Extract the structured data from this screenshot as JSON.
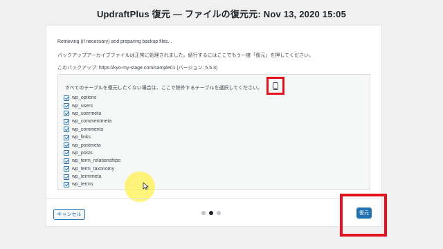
{
  "dialog": {
    "title": "UpdraftPlus 復元 — ファイルの復元元: Nov 13, 2020 15:05"
  },
  "panel": {
    "status_line": "Retrieving (if necessary) and preparing backup files...",
    "processed_message": "バックアップアーカイブファイルは正常に処理されました。続行するにはここでもう一度「復元」を押してください。",
    "backup_line": "このバックアップ: https://kyo-my-stage.com/sample01 (バージョン: 5.5.3)",
    "table_select_hint": "すべてのテーブルを復元したくない場合は、ここで除外するテーブルを選択してください。",
    "tables": [
      {
        "name": "wp_options",
        "checked": true
      },
      {
        "name": "wp_users",
        "checked": true
      },
      {
        "name": "wp_usermeta",
        "checked": true
      },
      {
        "name": "wp_commentmeta",
        "checked": true
      },
      {
        "name": "wp_comments",
        "checked": true
      },
      {
        "name": "wp_links",
        "checked": true
      },
      {
        "name": "wp_postmeta",
        "checked": true
      },
      {
        "name": "wp_posts",
        "checked": true
      },
      {
        "name": "wp_term_relationships",
        "checked": true
      },
      {
        "name": "wp_term_taxonomy",
        "checked": true
      },
      {
        "name": "wp_termmeta",
        "checked": true
      },
      {
        "name": "wp_terms",
        "checked": true
      }
    ]
  },
  "footer": {
    "cancel_label": "キャンセル",
    "restore_label": "復元",
    "step_current": 2,
    "step_total": 3
  },
  "colors": {
    "accent": "#2271b1",
    "highlight": "#e3101e",
    "cursor_glow": "#fff050"
  },
  "icons": {
    "select_tables": "tablet-icon",
    "cursor": "mouse-pointer-icon"
  }
}
